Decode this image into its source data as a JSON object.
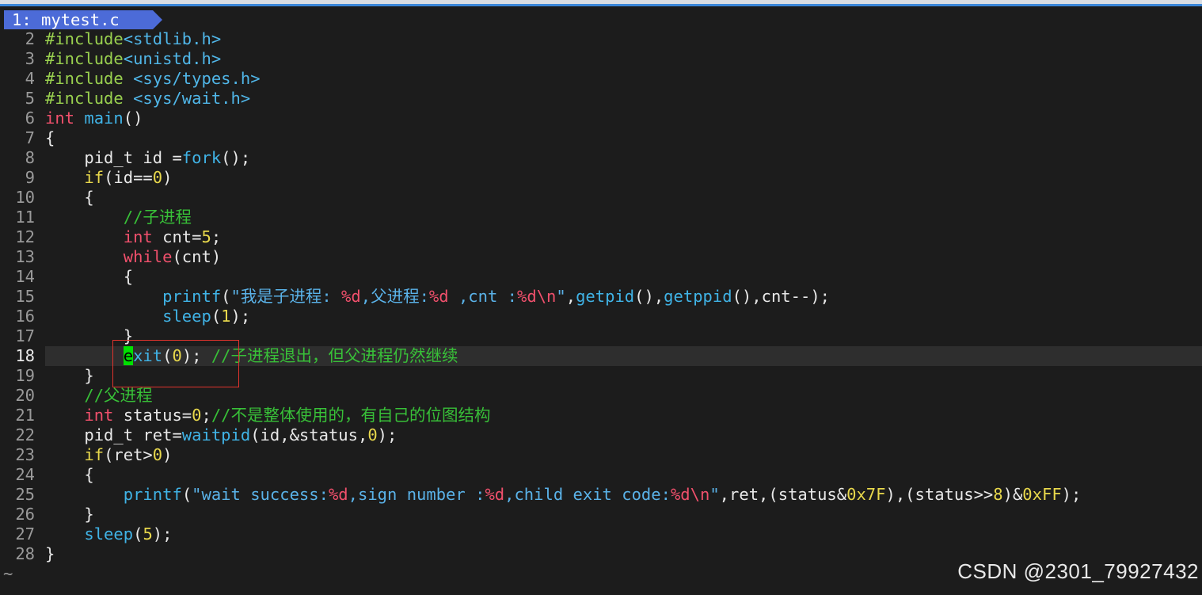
{
  "tab": {
    "label": "1: mytest.c"
  },
  "editor": {
    "cursor_line": "18",
    "lines": [
      {
        "n": "2",
        "t": "#include<stdlib.h>"
      },
      {
        "n": "3",
        "t": "#include<unistd.h>"
      },
      {
        "n": "4",
        "t": "#include <sys/types.h>"
      },
      {
        "n": "5",
        "t": "#include <sys/wait.h>"
      },
      {
        "n": "6",
        "t": "int main()"
      },
      {
        "n": "7",
        "t": "{"
      },
      {
        "n": "8",
        "t": "    pid_t id =fork();"
      },
      {
        "n": "9",
        "t": "    if(id==0)"
      },
      {
        "n": "10",
        "t": "    {"
      },
      {
        "n": "11",
        "t": "        //子进程"
      },
      {
        "n": "12",
        "t": "        int cnt=5;"
      },
      {
        "n": "13",
        "t": "        while(cnt)"
      },
      {
        "n": "14",
        "t": "        {"
      },
      {
        "n": "15",
        "t": "            printf(\"我是子进程: %d,父进程:%d ,cnt :%d\\n\",getpid(),getppid(),cnt--);"
      },
      {
        "n": "16",
        "t": "            sleep(1);"
      },
      {
        "n": "17",
        "t": "        }"
      },
      {
        "n": "18",
        "t": "        exit(0); //子进程退出，但父进程仍然继续"
      },
      {
        "n": "19",
        "t": "    }"
      },
      {
        "n": "20",
        "t": "    //父进程"
      },
      {
        "n": "21",
        "t": "    int status=0;//不是整体使用的，有自己的位图结构"
      },
      {
        "n": "22",
        "t": "    pid_t ret=waitpid(id,&status,0);"
      },
      {
        "n": "23",
        "t": "    if(ret>0)"
      },
      {
        "n": "24",
        "t": "    {"
      },
      {
        "n": "25",
        "t": "        printf(\"wait success:%d,sign number :%d,child exit code:%d\\n\",ret,(status&0x7F),(status>>8)&0xFF);"
      },
      {
        "n": "26",
        "t": "    }"
      },
      {
        "n": "27",
        "t": "    sleep(5);"
      },
      {
        "n": "28",
        "t": "}"
      }
    ],
    "tilde": "~"
  },
  "watermark": "CSDN @2301_79927432",
  "colors": {
    "background": "#1c1c1c",
    "tab": "#4c6bd8",
    "cursor": "#00e000",
    "annotation_box": "#e0332d"
  }
}
